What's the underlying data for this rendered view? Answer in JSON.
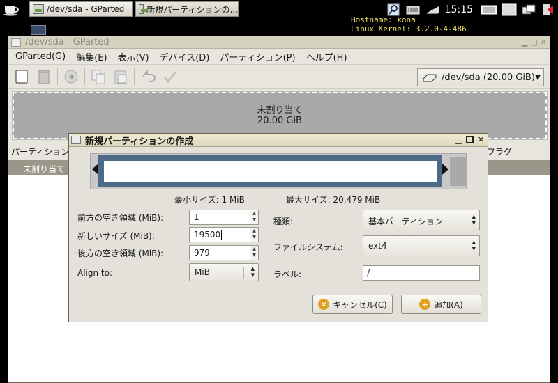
{
  "taskbar": {
    "tasks": [
      {
        "label": "/dev/sda - GParted"
      },
      {
        "label": "新規パーティションの..."
      }
    ],
    "clock": "15:15",
    "sysinfo": [
      "Hostname: kona",
      "Linux Kernel: 3.2.0-4-486"
    ]
  },
  "window": {
    "title": "/dev/sda - GParted",
    "menu": [
      "GParted(G)",
      "編集(E)",
      "表示(V)",
      "デバイス(D)",
      "パーティション(P)",
      "ヘルプ(H)"
    ],
    "device": "/dev/sda  (20.00 GiB)",
    "diskmap": {
      "label": "未割り当て",
      "size": "20.00 GiB"
    },
    "columns": {
      "partition": "パーティション",
      "flags": "フラグ"
    },
    "rows": [
      {
        "partition": "未割り当て"
      }
    ]
  },
  "dialog": {
    "title": "新規パーティションの作成",
    "min_size": "最小サイズ: 1 MiB",
    "max_size": "最大サイズ: 20,479 MiB",
    "free_before": {
      "label": "前方の空き領域 (MiB):",
      "value": "1"
    },
    "new_size": {
      "label": "新しいサイズ (MiB):",
      "value": "19500"
    },
    "free_after": {
      "label": "後方の空き領域 (MiB):",
      "value": "979"
    },
    "align": {
      "label": "Align to:",
      "value": "MiB"
    },
    "type": {
      "label": "種類:",
      "value": "基本パーティション"
    },
    "filesystem": {
      "label": "ファイルシステム:",
      "value": "ext4"
    },
    "label_field": {
      "label": "ラベル:",
      "value": "/"
    },
    "cancel": "キャンセル(C)",
    "add": "追加(A)"
  }
}
